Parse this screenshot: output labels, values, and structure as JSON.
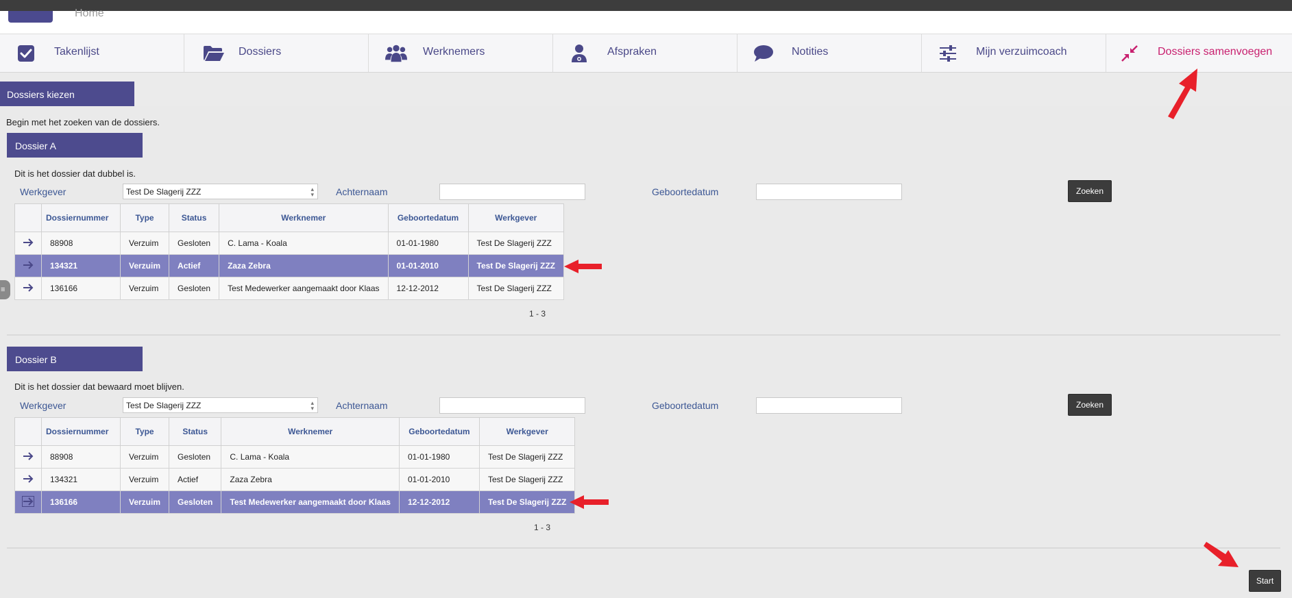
{
  "header": {
    "home_label": "Home"
  },
  "nav": [
    {
      "label": "Takenlijst",
      "icon": "checkbox-icon"
    },
    {
      "label": "Dossiers",
      "icon": "folder-open-icon"
    },
    {
      "label": "Werknemers",
      "icon": "users-icon"
    },
    {
      "label": "Afspraken",
      "icon": "doctor-icon"
    },
    {
      "label": "Notities",
      "icon": "speech-bubble-icon"
    },
    {
      "label": "Mijn verzuimcoach",
      "icon": "sliders-icon"
    },
    {
      "label": "Dossiers samenvoegen",
      "icon": "compress-arrows-icon",
      "active": true
    }
  ],
  "colors": {
    "primary": "#4d4b8e",
    "accent": "#c8206f",
    "selected_row": "#7f80c0",
    "label_blue": "#3c5794",
    "annotation_red": "#e8202a"
  },
  "page": {
    "tab_label": "Dossiers kiezen",
    "intro": "Begin met het zoeken van de dossiers.",
    "start_button": "Start"
  },
  "sections": [
    {
      "title": "Dossier A",
      "description": "Dit is het dossier dat dubbel is.",
      "form": {
        "werkgever_label": "Werkgever",
        "werkgever_value": "Test De Slagerij ZZZ",
        "achternaam_label": "Achternaam",
        "achternaam_value": "",
        "geboortedatum_label": "Geboortedatum",
        "geboortedatum_value": "",
        "search_button": "Zoeken"
      },
      "table": {
        "columns": [
          "Dossiernummer",
          "Type",
          "Status",
          "Werknemer",
          "Geboortedatum",
          "Werkgever"
        ],
        "rows": [
          [
            "88908",
            "Verzuim",
            "Gesloten",
            "C. Lama - Koala",
            "01-01-1980",
            "Test De Slagerij ZZZ"
          ],
          [
            "134321",
            "Verzuim",
            "Actief",
            "Zaza Zebra",
            "01-01-2010",
            "Test De Slagerij ZZZ"
          ],
          [
            "136166",
            "Verzuim",
            "Gesloten",
            "Test Medewerker aangemaakt door Klaas",
            "12-12-2012",
            "Test De Slagerij ZZZ"
          ]
        ],
        "selected_row": 1,
        "pager": "1 - 3"
      }
    },
    {
      "title": "Dossier B",
      "description": "Dit is het dossier dat bewaard moet blijven.",
      "form": {
        "werkgever_label": "Werkgever",
        "werkgever_value": "Test De Slagerij ZZZ",
        "achternaam_label": "Achternaam",
        "achternaam_value": "",
        "geboortedatum_label": "Geboortedatum",
        "geboortedatum_value": "",
        "search_button": "Zoeken"
      },
      "table": {
        "columns": [
          "Dossiernummer",
          "Type",
          "Status",
          "Werknemer",
          "Geboortedatum",
          "Werkgever"
        ],
        "rows": [
          [
            "88908",
            "Verzuim",
            "Gesloten",
            "C. Lama - Koala",
            "01-01-1980",
            "Test De Slagerij ZZZ"
          ],
          [
            "134321",
            "Verzuim",
            "Actief",
            "Zaza Zebra",
            "01-01-2010",
            "Test De Slagerij ZZZ"
          ],
          [
            "136166",
            "Verzuim",
            "Gesloten",
            "Test Medewerker aangemaakt door Klaas",
            "12-12-2012",
            "Test De Slagerij ZZZ"
          ]
        ],
        "selected_row": 2,
        "pager": "1 - 3"
      }
    }
  ]
}
